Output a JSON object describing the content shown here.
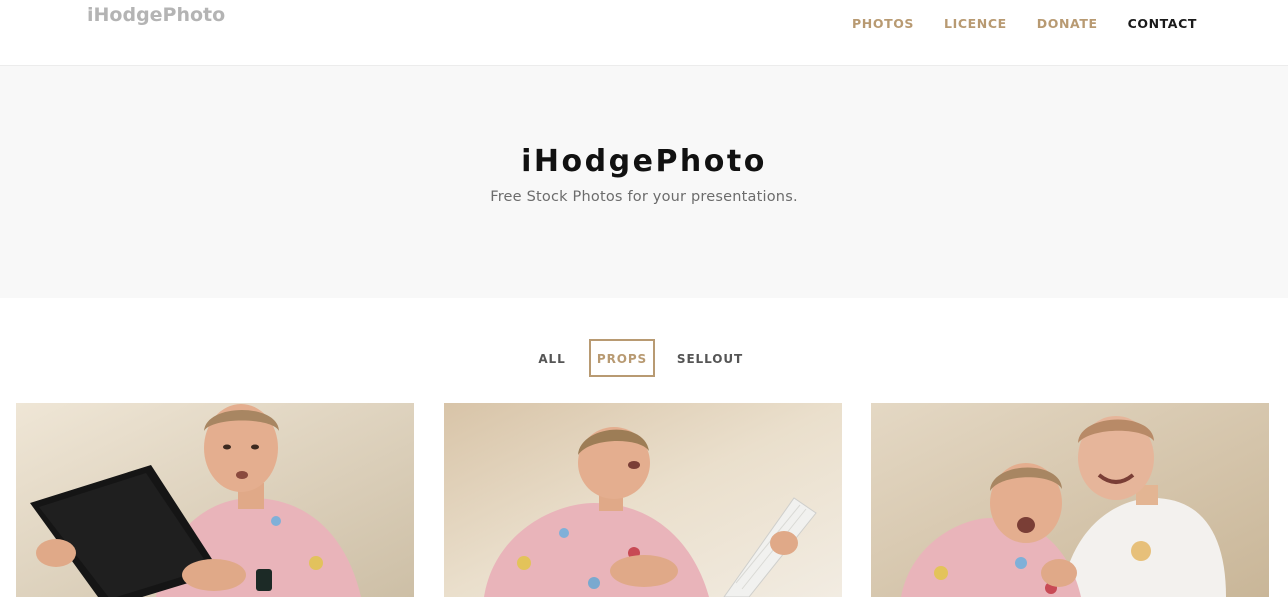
{
  "header": {
    "logo": "iHodgePhoto",
    "nav": [
      {
        "label": "PHOTOS"
      },
      {
        "label": "LICENCE"
      },
      {
        "label": "DONATE"
      },
      {
        "label": "CONTACT"
      }
    ]
  },
  "hero": {
    "title": "iHodgePhoto",
    "subtitle": "Free Stock Photos for your presentations."
  },
  "filters": {
    "items": [
      {
        "label": "ALL"
      },
      {
        "label": "PROPS"
      },
      {
        "label": "SELLOUT"
      }
    ],
    "active": "PROPS"
  },
  "gallery": {
    "photos": [
      {
        "subject": "man-holding-monitor"
      },
      {
        "subject": "man-holding-keyboard"
      },
      {
        "subject": "man-with-cardboard-cutout"
      }
    ]
  },
  "colors": {
    "accent": "#b89a72",
    "logo": "#b4b4b4",
    "hero_bg": "#f8f8f8",
    "nav_active": "#1a1a1a"
  }
}
